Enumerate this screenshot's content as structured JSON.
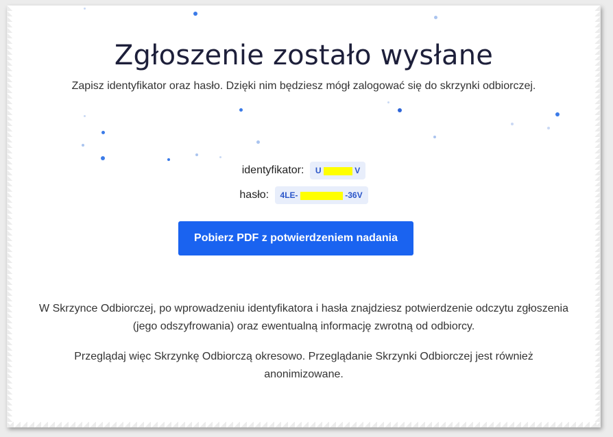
{
  "page": {
    "title": "Zgłoszenie zostało wysłane",
    "subtitle": "Zapisz identyfikator oraz hasło. Dzięki nim będziesz mógł zalogować się do skrzynki odbiorczej.",
    "identifier": {
      "label": "identyfikator:",
      "value_prefix": "U",
      "value_suffix": "V"
    },
    "password": {
      "label": "hasło:",
      "value_prefix": "4LE-",
      "value_suffix": "-36V"
    },
    "download_button": "Pobierz PDF z potwierdzeniem nadania",
    "paragraph1": "W Skrzynce Odbiorczej, po wprowadzeniu identyfikatora i hasła znajdziesz potwierdzenie odczytu zgłoszenia (jego odszyfrowania) oraz ewentualną informację zwrotną od odbiorcy.",
    "paragraph2": "Przeglądaj więc Skrzynkę Odbiorczą okresowo. Przeglądanie Skrzynki Odbiorczej jest również anonimizowane."
  },
  "colors": {
    "button": "#1a63f0",
    "badge_bg": "#e8eefb",
    "badge_text": "#2b56c9",
    "redaction": "#ffff00",
    "dots": "#3b7be8"
  }
}
